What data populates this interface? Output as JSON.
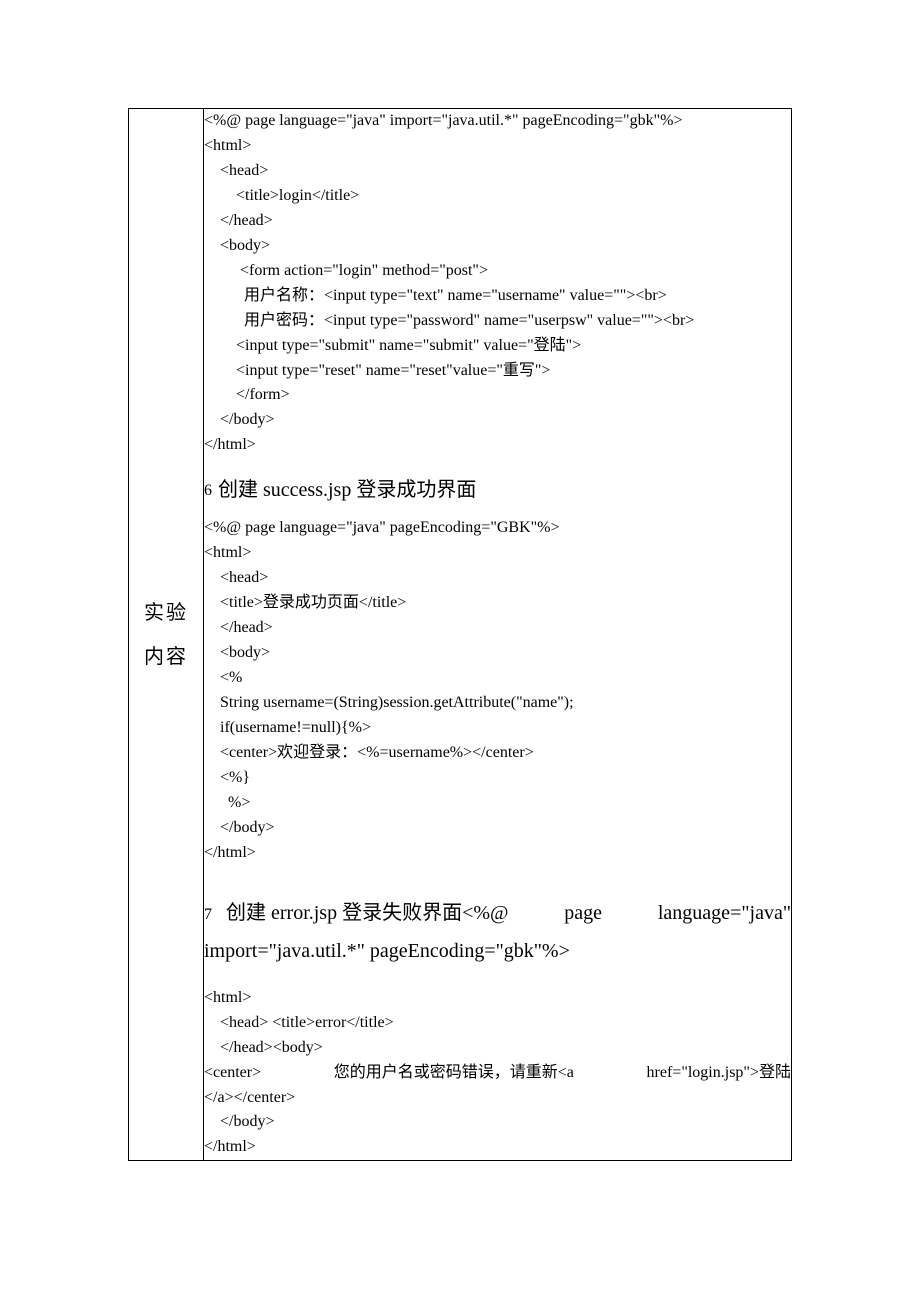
{
  "leftLabel": {
    "line1": "实验",
    "line2": "内容"
  },
  "block1": {
    "l1": "<%@ page language=\"java\" import=\"java.util.*\" pageEncoding=\"gbk\"%>",
    "l2": "<html>",
    "l3": "    <head>",
    "l4": "        <title>login</title>",
    "l5": "    </head>",
    "l6": "    <body>",
    "l7": "         <form action=\"login\" method=\"post\">",
    "l8": "          用户名称：<input type=\"text\" name=\"username\" value=\"\"><br>",
    "l9": "          用户密码：<input type=\"password\" name=\"userpsw\" value=\"\"><br>",
    "l10": "        <input type=\"submit\" name=\"submit\" value=\"登陆\">",
    "l11": "        <input type=\"reset\" name=\"reset\"value=\"重写\">",
    "l12": "        </form>",
    "l13": "    </body>",
    "l14": "</html>"
  },
  "heading6": {
    "num": "6",
    "text": "创建 success.jsp 登录成功界面"
  },
  "block2": {
    "l1": "<%@ page language=\"java\" pageEncoding=\"GBK\"%>",
    "l2": "<html>",
    "l3": "    <head>",
    "l4": "    <title>登录成功页面</title>",
    "l5": "    </head>",
    "l6": "    <body>",
    "l7": "    <%",
    "l8": "    String username=(String)session.getAttribute(\"name\");",
    "l9": "    if(username!=null){%>",
    "l10": "    <center>欢迎登录：<%=username%></center>",
    "l11": "    <%}",
    "l12": "      %>",
    "l13": "    </body>",
    "l14": "</html>"
  },
  "heading7": {
    "part1_num": "7",
    "part1_a": "创建 error.jsp 登录失败界面<%@",
    "part1_b": "page",
    "part1_c": "language=\"java\"",
    "part2": "import=\"java.util.*\" pageEncoding=\"gbk\"%>"
  },
  "block3": {
    "l1": "<html>",
    "l2": "    <head> <title>error</title>",
    "l3": "    </head><body>",
    "l4a": "        <center>",
    "l4b": "您的用户名或密码错误，请重新<a",
    "l4c": "href=\"login.jsp\">登陆",
    "l5": "</a></center>",
    "l6": "    </body>",
    "l7": "</html>"
  }
}
